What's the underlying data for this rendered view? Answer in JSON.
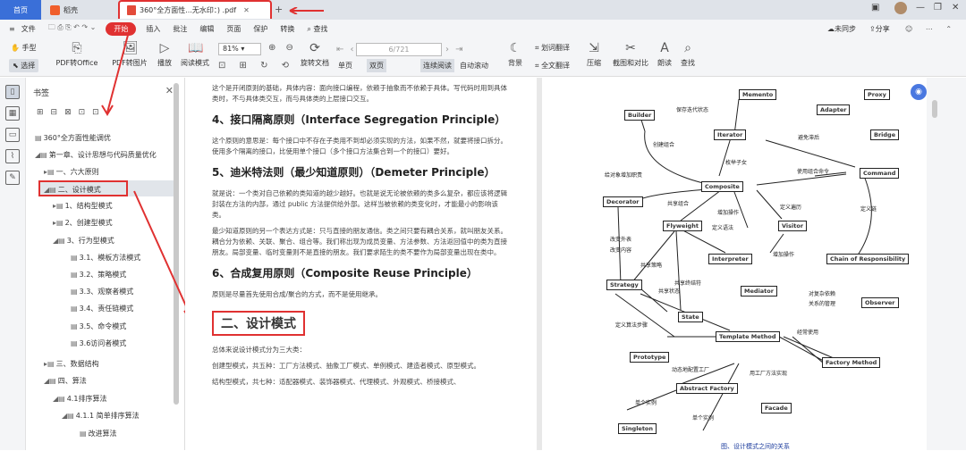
{
  "tabs": {
    "home": "首页",
    "wps": "稻壳",
    "pdf": "360°全方面性...无水印：) .pdf"
  },
  "menu": [
    "文件",
    "开始",
    "插入",
    "批注",
    "编辑",
    "页面",
    "保护",
    "转换"
  ],
  "menu_search": "查找",
  "menu_right": {
    "save": "未同步",
    "share": "分享"
  },
  "toolbar": {
    "hand": "手型",
    "select": "选择",
    "pdf2office": "PDF转Office",
    "pdf2img": "PDF转图片",
    "play": "播放",
    "readmode": "阅读模式",
    "zoom": "81%",
    "rotate": "旋转文档",
    "single": "单页",
    "double": "双页",
    "continuous": "连续阅读",
    "autoscroll": "自动滚动",
    "page_indicator": "6/721",
    "bg": "背景",
    "translate": "划词翻译",
    "fulltrans": "全文翻译",
    "compress": "压缩",
    "screenshot": "截图和对比",
    "read": "朗读",
    "find": "查找"
  },
  "panel": {
    "title": "书签",
    "items": [
      {
        "label": "360°全方面性能调优"
      },
      {
        "label": "第一章、设计思想与代码质量优化"
      },
      {
        "label": "一、六大原则"
      },
      {
        "label": "二、设计模式"
      },
      {
        "label": "1、结构型模式"
      },
      {
        "label": "2、创建型模式"
      },
      {
        "label": "3、行为型模式"
      },
      {
        "label": "3.1、模板方法模式"
      },
      {
        "label": "3.2、策略模式"
      },
      {
        "label": "3.3、观察者模式"
      },
      {
        "label": "3.4、责任链模式"
      },
      {
        "label": "3.5、命令模式"
      },
      {
        "label": "3.6访问者模式"
      },
      {
        "label": "三、数据结构"
      },
      {
        "label": "四、算法"
      },
      {
        "label": "4.1排序算法"
      },
      {
        "label": "4.1.1 简单排序算法"
      },
      {
        "label": "改进算法"
      }
    ]
  },
  "doc": {
    "p0": "这个是开闭原则的基础，具体内容：面向接口编程，依赖于抽象而不依赖于具体。写代码时用到具体类时，不与具体类交互，而与具体类的上层接口交互。",
    "h4": "4、接口隔离原则（Interface Segregation Principle）",
    "p4": "这个原则的意思是：每个接口中不存在子类用不到却必须实现的方法，如果不然，就要将接口拆分。使用多个隔离的接口，比使用单个接口（多个接口方法集合到一个的接口）要好。",
    "h5": "5、迪米特法则（最少知道原则）（Demeter Principle）",
    "p5a": "就是说：一个类对自己依赖的类知道的越少越好。也就是说无论被依赖的类多么复杂，都应该将逻辑封装在方法的内部，通过 public 方法提供给外部。这样当被依赖的类变化时，才能最小的影响该类。",
    "p5b": "最少知道原则的另一个表达方式是：只与直接的朋友通信。类之间只要有耦合关系，就叫朋友关系。耦合分为依赖、关联、聚合、组合等。我们称出现为成员变量、方法参数、方法返回值中的类为直接朋友。局部变量、临时变量则不是直接的朋友。我们要求陌生的类不要作为局部变量出现在类中。",
    "h6": "6、合成复用原则（Composite Reuse Principle）",
    "p6": "原则是尽量首先使用合成/聚合的方式，而不是使用继承。",
    "section": "二、设计模式",
    "p7": "总体来说设计模式分为三大类：",
    "p8": "创建型模式，共五种：工厂方法模式、抽象工厂模式、单例模式、建造者模式、原型模式。",
    "p9": "结构型模式，共七种：适配器模式、装饰器模式、代理模式、外观模式、桥接模式、"
  },
  "diagram": {
    "nodes": [
      "Memento",
      "Proxy",
      "Builder",
      "Iterator",
      "Adapter",
      "Bridge",
      "Composite",
      "Command",
      "Decorator",
      "Flyweight",
      "Visitor",
      "Interpreter",
      "Chain of Responsibility",
      "Strategy",
      "Mediator",
      "Observer",
      "State",
      "Template Method",
      "Prototype",
      "Factory Method",
      "Abstract Factory",
      "Facade",
      "Singleton"
    ],
    "labels": [
      "保存迭代状态",
      "避免滞后",
      "创建组合",
      "枚举子女",
      "使用组合命令",
      "给对象增加职责",
      "共享组合",
      "增加操作",
      "定义遍历",
      "定义链",
      "定义语法",
      "改变外表",
      "改变内容",
      "共享策略",
      "增加操作",
      "共享终结符",
      "共享状态",
      "对复杂依赖",
      "关系的管理",
      "定义算法步骤",
      "经常使用",
      "动态地配置工厂",
      "用工厂方法实现",
      "单个实例",
      "单个实例"
    ],
    "caption": "图、设计模式之间的关系"
  },
  "colors": {
    "accent": "#e03131",
    "tab_blue": "#3a6fd8"
  }
}
